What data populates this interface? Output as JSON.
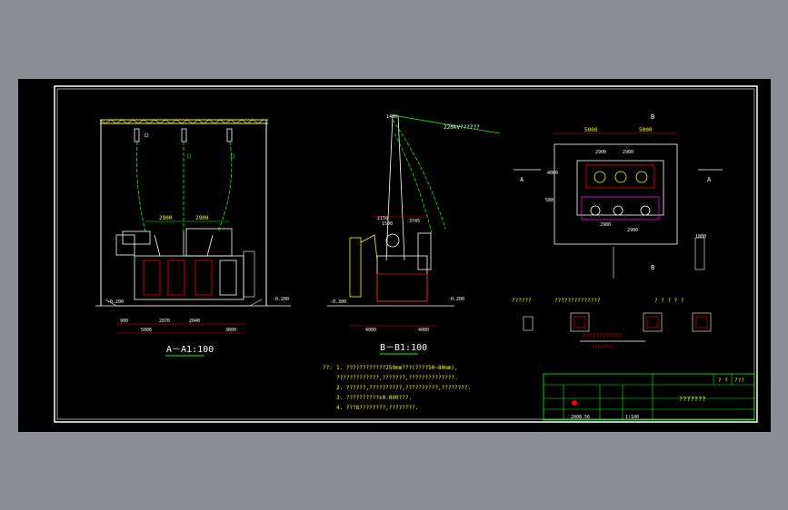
{
  "drawing": {
    "view_a_title": "A－A1:100",
    "view_b_title": "B－B1:100",
    "dims_a": {
      "top_left": "2900",
      "top_right": "2900",
      "bottom_total": "5000",
      "bottom_left": "2070",
      "bottom_right": "2040",
      "bottom_outer_left": "900",
      "bottom_outer_right": "3000",
      "left_level": "-0.200",
      "right_level": "-0.200"
    },
    "dims_b": {
      "wire_label": "220kV??????",
      "top_left": "1400",
      "d1": "2150",
      "d2": "1500",
      "d3": "3745",
      "left_base": "4000",
      "right_base": "4000",
      "left_level": "-0.300",
      "right_level": "-0.200"
    },
    "plan_dims": {
      "top_left": "5000",
      "top_right": "5000",
      "inner_top": "2900",
      "inner_top2": "2900",
      "left_side": "4000",
      "left_small": "580",
      "right_small": "1800",
      "bottom_inner": "2900",
      "bottom_inner2": "2900",
      "side_a_left": "A",
      "side_a_right": "A",
      "side_b_top": "B",
      "side_b_bottom": "B"
    },
    "detail_labels": {
      "label1": "??????",
      "label2": "??????????????",
      "label3": "? ? ? ? ?"
    },
    "notes_prefix": "??:",
    "notes": [
      "1.  ????????????250mm???(????50~80mm),",
      "     ?????????????,???????,??????????????.",
      "2.  ??????,??????????,??????????,????????.",
      "3.  ??????????±0.000???.",
      "4.  ???8????????,????????."
    ],
    "red_title": "????????????",
    "red_sub": "???(???)",
    "title_block": {
      "r1c1": "? ?",
      "r1c2": "???",
      "center": "???????",
      "scale_date": "2008.56",
      "scale": "1:100"
    },
    "colors": {
      "frame": "#ffffff",
      "green": "#00ff00",
      "yellow": "#ffff00",
      "cyan": "#00ffff",
      "red": "#ff0000",
      "white": "#ffffff"
    }
  }
}
